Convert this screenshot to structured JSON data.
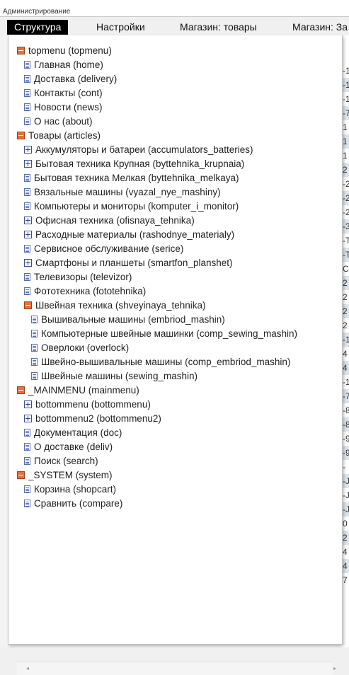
{
  "window": {
    "title": "Администрирование"
  },
  "menu": {
    "items": [
      {
        "label": "Структура",
        "active": true
      },
      {
        "label": "Настройки",
        "active": false
      },
      {
        "label": "Магазин: товары",
        "active": false
      },
      {
        "label": "Магазин: За",
        "active": false
      }
    ]
  },
  "tree": {
    "nodes": [
      {
        "label": "topmenu (topmenu)",
        "icon": "minus",
        "level": 0
      },
      {
        "label": "Главная (home)",
        "icon": "doc",
        "level": 1
      },
      {
        "label": "Доставка (delivery)",
        "icon": "doc",
        "level": 1
      },
      {
        "label": "Контакты (cont)",
        "icon": "doc",
        "level": 1
      },
      {
        "label": "Новости (news)",
        "icon": "doc",
        "level": 1
      },
      {
        "label": "О нас (about)",
        "icon": "doc",
        "level": 1
      },
      {
        "label": "Товары (articles)",
        "icon": "minus",
        "level": 0
      },
      {
        "label": "Аккумуляторы и батареи (accumulators_batteries)",
        "icon": "plus",
        "level": 1
      },
      {
        "label": "Бытовая техника Крупная (byttehnika_krupnaia)",
        "icon": "plus",
        "level": 1
      },
      {
        "label": "Бытовая техника Мелкая (byttehnika_melkaya)",
        "icon": "doc",
        "level": 1
      },
      {
        "label": "Вязальные машины (vyazal_nye_mashiny)",
        "icon": "doc",
        "level": 1
      },
      {
        "label": "Компьютеры и мониторы (komputer_i_monitor)",
        "icon": "doc",
        "level": 1
      },
      {
        "label": "Офисная техника (ofisnaya_tehnika)",
        "icon": "plus",
        "level": 1
      },
      {
        "label": "Расходные материалы (rashodnye_materialy)",
        "icon": "plus",
        "level": 1
      },
      {
        "label": "Сервисное обслуживание (serice)",
        "icon": "doc",
        "level": 1
      },
      {
        "label": "Смартфоны и планшеты (smartfon_planshet)",
        "icon": "plus",
        "level": 1
      },
      {
        "label": "Телевизоры (televizor)",
        "icon": "doc",
        "level": 1
      },
      {
        "label": "Фототехника (fototehnika)",
        "icon": "doc",
        "level": 1
      },
      {
        "label": "Швейная техника (shveyinaya_tehnika)",
        "icon": "minus",
        "level": 1
      },
      {
        "label": "Вышивальные машины (embriod_mashin)",
        "icon": "doc",
        "level": 2
      },
      {
        "label": "Компьютерные швейные машинки (comp_sewing_mashin)",
        "icon": "doc",
        "level": 2
      },
      {
        "label": "Оверлоки (overlock)",
        "icon": "doc",
        "level": 2
      },
      {
        "label": "Швейно-вышивальные машины (comp_embriod_mashin)",
        "icon": "doc",
        "level": 2
      },
      {
        "label": "Швейные машины (sewing_mashin)",
        "icon": "doc",
        "level": 2
      },
      {
        "label": "_MAINMENU (mainmenu)",
        "icon": "minus",
        "level": 0
      },
      {
        "label": "bottommenu (bottommenu)",
        "icon": "plus",
        "level": 1
      },
      {
        "label": "bottommenu2 (bottommenu2)",
        "icon": "plus",
        "level": 1
      },
      {
        "label": "Документация (doc)",
        "icon": "doc",
        "level": 1
      },
      {
        "label": "О доставке (deliv)",
        "icon": "doc",
        "level": 1
      },
      {
        "label": "Поиск (search)",
        "icon": "doc",
        "level": 1
      },
      {
        "label": "_SYSTEM (system)",
        "icon": "minus",
        "level": 0
      },
      {
        "label": "Корзина (shopcart)",
        "icon": "doc",
        "level": 1
      },
      {
        "label": "Сравнить (compare)",
        "icon": "doc",
        "level": 1
      }
    ]
  },
  "background_column": {
    "cells": [
      "-1",
      "-1",
      "-1",
      "-7",
      "1",
      "1",
      "1",
      "2",
      "-2",
      "-2",
      "-2",
      "-3",
      "-T",
      "-T",
      "C",
      "2",
      "2",
      "2",
      "2",
      "-1",
      "4",
      "4",
      "-1",
      "-7",
      "-8",
      "-8",
      "-9",
      "-9",
      "-",
      "-J",
      "-J",
      "-J",
      "0",
      "2",
      "4",
      "4",
      "7"
    ]
  },
  "scrollbar": {
    "left_arrow": "◂",
    "right_arrow": "▸"
  }
}
